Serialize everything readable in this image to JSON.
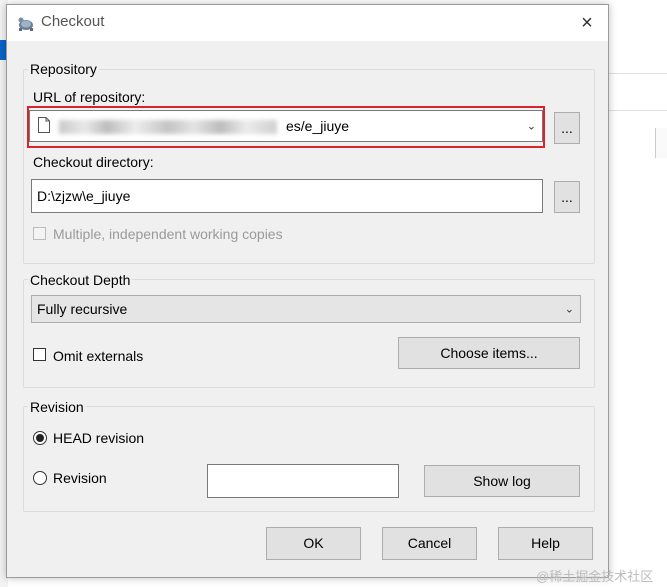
{
  "window": {
    "title": "Checkout",
    "close_icon": "×"
  },
  "repository": {
    "group_title": "Repository",
    "url_label": "URL of repository:",
    "url_value_visible": "es/e_jiuye",
    "browse_label": "...",
    "dir_label": "Checkout directory:",
    "dir_value": "D:\\zjzw\\e_jiuye",
    "dir_browse_label": "...",
    "multiple_label": "Multiple, independent working copies"
  },
  "depth": {
    "group_title": "Checkout Depth",
    "selected": "Fully recursive",
    "omit_externals_label": "Omit externals",
    "choose_items_label": "Choose items..."
  },
  "revision": {
    "group_title": "Revision",
    "head_label": "HEAD revision",
    "revision_label": "Revision",
    "revision_value": "",
    "show_log_label": "Show log"
  },
  "buttons": {
    "ok": "OK",
    "cancel": "Cancel",
    "help": "Help"
  },
  "watermark": "@稀土掘金技术社区",
  "colors": {
    "highlight_box": "#d9232f",
    "dialog_bg": "#f0f0f0",
    "accent_blue": "#0a64c8"
  }
}
